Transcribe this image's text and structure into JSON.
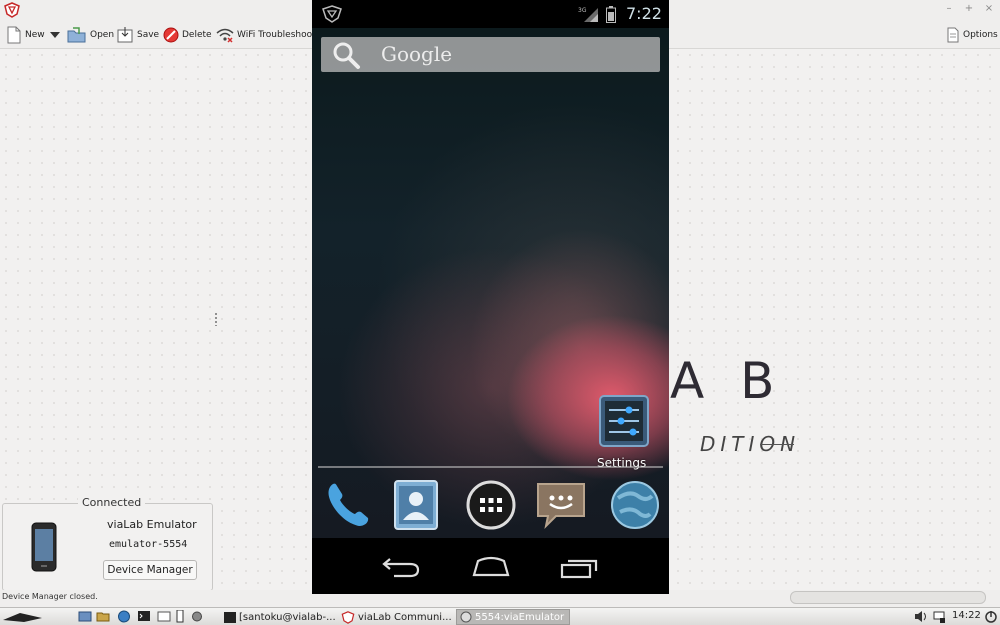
{
  "toolbar": {
    "new_label": "New",
    "open_label": "Open",
    "save_label": "Save",
    "delete_label": "Delete",
    "wifi_label": "WiFi Troubleshootin",
    "options_label": "Options"
  },
  "brand": {
    "text": "A B",
    "subtitle": "DITION"
  },
  "connected_panel": {
    "title": "Connected",
    "device_name": "viaLab Emulator",
    "device_id": "emulator-5554",
    "device_manager_label": "Device Manager"
  },
  "status_bar": {
    "message": "Device Manager closed."
  },
  "taskbar": {
    "terminal_label": "[santoku@vialab-...",
    "vialab_label": "viaLab Communi...",
    "emulator_label": "5554:viaEmulator",
    "clock": "14:22"
  },
  "emulator": {
    "clock": "7:22",
    "network": "3G",
    "search_label": "Google",
    "settings_label": "Settings",
    "dock": [
      "phone-icon",
      "contacts-icon",
      "app-drawer-icon",
      "messaging-icon",
      "browser-icon"
    ],
    "nav": [
      "back-icon",
      "home-icon",
      "recent-apps-icon"
    ]
  },
  "colors": {
    "window_bg": "#efeeed",
    "emulator_bg": "#000000",
    "accent_pink": "#e85c6e",
    "clock_text": "#cfe0e6"
  }
}
